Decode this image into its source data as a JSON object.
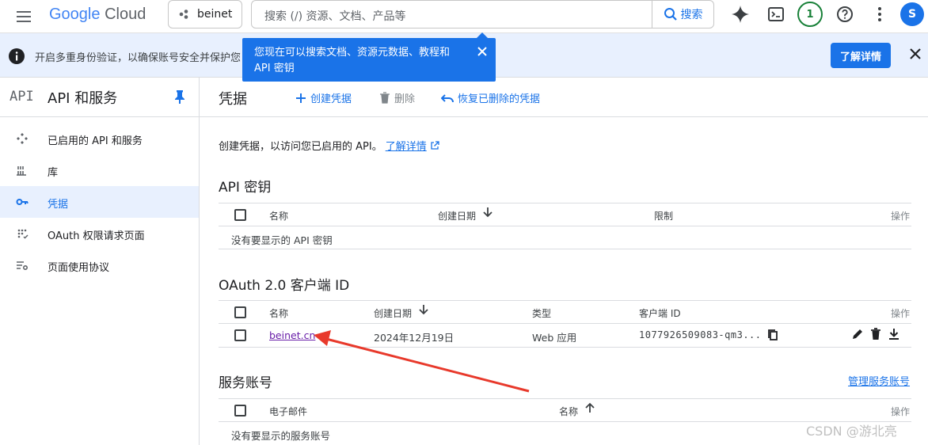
{
  "header": {
    "logo_google": "Google",
    "logo_cloud": "Cloud",
    "project": "beinet",
    "search_placeholder": "搜索 (/) 资源、文档、产品等",
    "search_button": "搜索",
    "notification_count": "1",
    "avatar_letter": "S"
  },
  "banner": {
    "text": "开启多重身份验证，以确保账号安全并保护您",
    "learn_more": "了解详情"
  },
  "tooltip": {
    "text": "您现在可以搜索文档、资源元数据、教程和 API 密钥"
  },
  "sidebar": {
    "api_label": "API",
    "title": "API 和服务",
    "items": [
      {
        "label": "已启用的 API 和服务",
        "icon": "diamond-grid-icon"
      },
      {
        "label": "库",
        "icon": "library-icon"
      },
      {
        "label": "凭据",
        "icon": "key-icon"
      },
      {
        "label": "OAuth 权限请求页面",
        "icon": "consent-icon"
      },
      {
        "label": "页面使用协议",
        "icon": "settings-list-icon"
      }
    ]
  },
  "main": {
    "title": "凭据",
    "actions": {
      "create": "创建凭据",
      "delete": "删除",
      "restore": "恢复已删除的凭据"
    },
    "intro": "创建凭据，以访问您已启用的 API。",
    "intro_link": "了解详情",
    "api_keys": {
      "title": "API 密钥",
      "columns": [
        "名称",
        "创建日期",
        "限制",
        "操作"
      ],
      "empty": "没有要显示的 API 密钥"
    },
    "oauth": {
      "title": "OAuth 2.0 客户端 ID",
      "columns": [
        "名称",
        "创建日期",
        "类型",
        "客户端 ID",
        "操作"
      ],
      "rows": [
        {
          "name": "beinet.cn",
          "date": "2024年12月19日",
          "type": "Web 应用",
          "client_id": "1077926509083-qm3..."
        }
      ]
    },
    "service_accounts": {
      "title": "服务账号",
      "manage_link": "管理服务账号",
      "columns": [
        "电子邮件",
        "名称",
        "操作"
      ],
      "empty": "没有要显示的服务账号"
    }
  },
  "watermark": "CSDN @游北亮",
  "colors": {
    "accent": "#1a73e8",
    "annotation_arrow": "#e8392b"
  }
}
